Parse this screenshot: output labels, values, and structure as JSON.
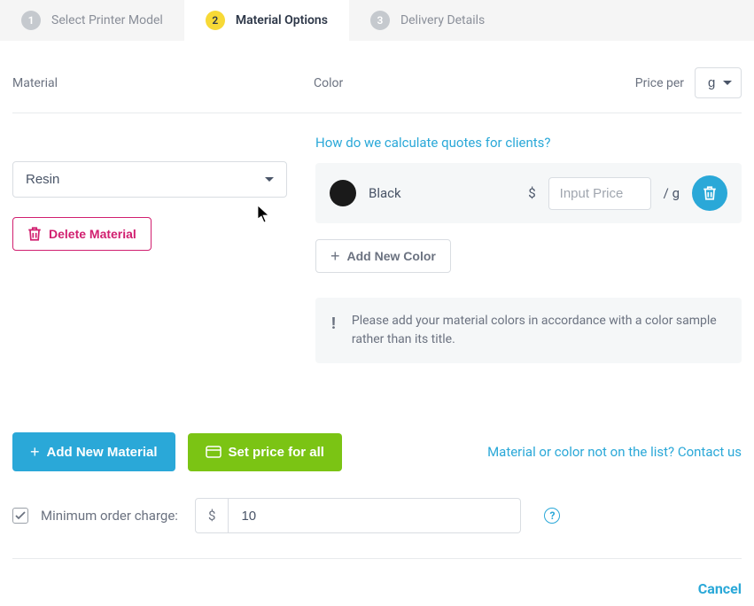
{
  "tabs": [
    {
      "num": "1",
      "label": "Select Printer Model"
    },
    {
      "num": "2",
      "label": "Material Options"
    },
    {
      "num": "3",
      "label": "Delivery Details"
    }
  ],
  "headers": {
    "material": "Material",
    "color": "Color",
    "price_per": "Price per"
  },
  "unit": "g",
  "material": {
    "selected": "Resin",
    "delete_label": "Delete Material"
  },
  "quote_link": "How do we calculate quotes for clients?",
  "color_row": {
    "name": "Black",
    "currency": "$",
    "price_placeholder": "Input Price",
    "per_unit": "/ g"
  },
  "add_color_label": "Add New Color",
  "info": "Please add your material colors in accordance with a color sample rather than its title.",
  "actions": {
    "add_material": "Add New Material",
    "set_price": "Set price for all",
    "contact": "Material or color not on the list? Contact us"
  },
  "min_order": {
    "label": "Minimum order charge:",
    "currency": "$",
    "value": "10"
  },
  "footer": {
    "cancel": "Cancel"
  }
}
